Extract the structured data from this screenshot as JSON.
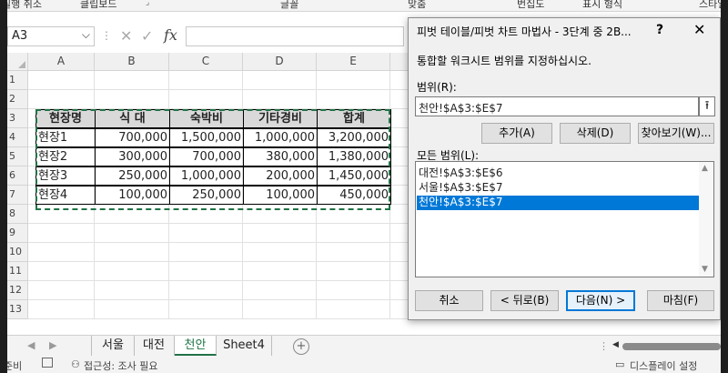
{
  "ribbon_groups": {
    "labels": [
      "실행 취소",
      "클립보드",
      "글꼴",
      "맞춤",
      "번집도",
      "표시 형식",
      "스타일"
    ]
  },
  "formula_bar": {
    "name_box": "A3",
    "formula": ""
  },
  "columns": [
    "A",
    "B",
    "C",
    "D",
    "E"
  ],
  "rows": [
    "1",
    "2",
    "3",
    "4",
    "5",
    "6",
    "7",
    "8",
    "9",
    "10",
    "11",
    "12",
    "13"
  ],
  "table": {
    "headers": [
      "현장명",
      "식 대",
      "숙박비",
      "기타경비",
      "합계"
    ],
    "rows": [
      [
        "현장1",
        "700,000",
        "1,500,000",
        "1,000,000",
        "3,200,000"
      ],
      [
        "현장2",
        "300,000",
        "700,000",
        "380,000",
        "1,380,000"
      ],
      [
        "현장3",
        "250,000",
        "1,000,000",
        "200,000",
        "1,450,000"
      ],
      [
        "현장4",
        "100,000",
        "250,000",
        "100,000",
        "450,000"
      ]
    ]
  },
  "sheet_tabs": [
    "서울",
    "대전",
    "천안",
    "Sheet4"
  ],
  "active_sheet": "천안",
  "status_bar": {
    "left": "준비",
    "accessibility": "접근성: 조사 필요",
    "right": "디스플레이 설정"
  },
  "dialog": {
    "title": "피벗 테이블/피벗 차트 마법사 - 3단계 중 2B...",
    "help": "?",
    "close": "✕",
    "instruction": "통합할 워크시트 범위를 지정하십시오.",
    "range_label": "범위(R):",
    "range_value": "천안!$A$3:$E$7",
    "add_button": "추가(A)",
    "delete_button": "삭제(D)",
    "browse_button": "찾아보기(W)...",
    "all_ranges_label": "모든 범위(L):",
    "all_ranges": [
      "대전!$A$3:$E$6",
      "서울!$A$3:$E$7",
      "천안!$A$3:$E$7"
    ],
    "selected_index": 2,
    "cancel_button": "취소",
    "back_button": "< 뒤로(B)",
    "next_button": "다음(N) >",
    "finish_button": "마침(F)"
  },
  "colors": {
    "accent_green": "#217346",
    "selection_blue": "#0078d7",
    "table_header_fill": "#d9d9d9"
  }
}
